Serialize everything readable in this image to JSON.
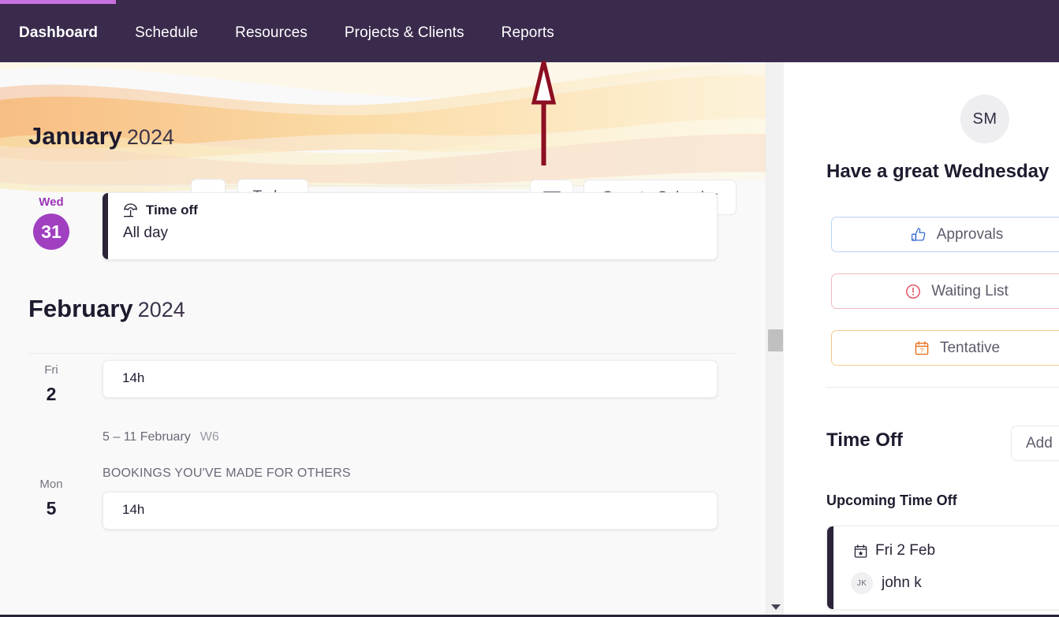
{
  "app": {
    "progress_percent": 11,
    "accent_purple": "#a13fc1",
    "nav_background": "#3a2b4d",
    "annotation_color": "#8c0f21"
  },
  "topnav": {
    "items": [
      {
        "label": "Dashboard",
        "active": true
      },
      {
        "label": "Schedule",
        "active": false
      },
      {
        "label": "Resources",
        "active": false
      },
      {
        "label": "Projects & Clients",
        "active": false
      },
      {
        "label": "Reports",
        "active": false
      }
    ]
  },
  "toolbar": {
    "month": "January",
    "year": "2024",
    "chevron_icon": "chevron-down-icon",
    "today_label": "Today",
    "sort_icon": "sort-filter-icon",
    "sync_label": "Sync to Calendar"
  },
  "calendar": {
    "months": [
      {
        "month": "January",
        "year": "2024",
        "days": [
          {
            "dow": "Wed",
            "dow_highlight": true,
            "num": "31",
            "num_badge": true,
            "card": {
              "type": "timeoff",
              "icon": "umbrella-icon",
              "title": "Time off",
              "subtitle": "All day"
            }
          }
        ]
      },
      {
        "month": "February",
        "year": "2024",
        "days": [
          {
            "dow": "Fri",
            "dow_highlight": false,
            "num": "2",
            "num_badge": false,
            "card": {
              "type": "hours",
              "hours": "14h"
            }
          }
        ],
        "week": {
          "range": "5 – 11 February",
          "week_number": "W6",
          "section_label": "BOOKINGS YOU'VE MADE FOR OTHERS",
          "days": [
            {
              "dow": "Mon",
              "dow_highlight": false,
              "num": "5",
              "num_badge": false,
              "card": {
                "type": "hours",
                "hours": "14h"
              }
            }
          ]
        }
      }
    ]
  },
  "scrollbar": {
    "thumb_position_percent": 48,
    "down_arrow_icon": "chevron-down-icon"
  },
  "sidebar": {
    "avatar_initials": "SM",
    "greeting": "Have a great Wednesday",
    "quick_links": [
      {
        "label": "Approvals",
        "icon": "thumbs-up-icon",
        "border_color": "#b9d3f5",
        "icon_color": "#3b6fd4"
      },
      {
        "label": "Waiting List",
        "icon": "exclamation-circle-icon",
        "border_color": "#f3b9bf",
        "icon_color": "#e2485c"
      },
      {
        "label": "Tentative",
        "icon": "calendar-question-icon",
        "border_color": "#f3c98b",
        "icon_color": "#e8701a"
      }
    ],
    "timeoff": {
      "heading": "Time Off",
      "add_label": "Add",
      "upcoming_label": "Upcoming Time Off",
      "entries": [
        {
          "date_icon": "calendar-star-icon",
          "date": "Fri 2 Feb",
          "person_initials": "JK",
          "person": "john k"
        }
      ]
    }
  },
  "annotation": {
    "type": "arrow-up",
    "points_to": "Reports"
  }
}
